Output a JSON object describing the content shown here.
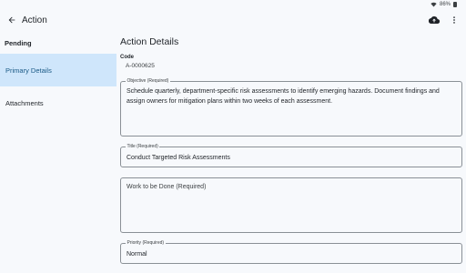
{
  "status_bar": {
    "battery": "86%"
  },
  "app_bar": {
    "title": "Action"
  },
  "sidebar": {
    "header": "Pending",
    "items": [
      {
        "label": "Primary Details",
        "active": true
      },
      {
        "label": "Attachments",
        "active": false
      }
    ]
  },
  "main": {
    "section_title": "Action Details",
    "code_label": "Code",
    "code_value": "A-0000625",
    "objective": {
      "label": "Objective (Required)",
      "value": "Schedule quarterly, department-specific risk assessments to identify emerging hazards. Document findings and assign owners for mitigation plans within two weeks of each assessment."
    },
    "title": {
      "label": "Title (Required)",
      "value": "Conduct Targeted Risk Assessments"
    },
    "work": {
      "placeholder": "Work to be Done (Required)"
    },
    "priority": {
      "label": "Priority (Required)",
      "value": "Normal"
    }
  },
  "colors": {
    "accent_bg": "#cfe6fb",
    "accent_text": "#1b5a86",
    "background": "#f7f9fc"
  },
  "icons": [
    "back-arrow-icon",
    "cloud-upload-icon",
    "more-vertical-icon",
    "wifi-icon",
    "battery-icon"
  ]
}
